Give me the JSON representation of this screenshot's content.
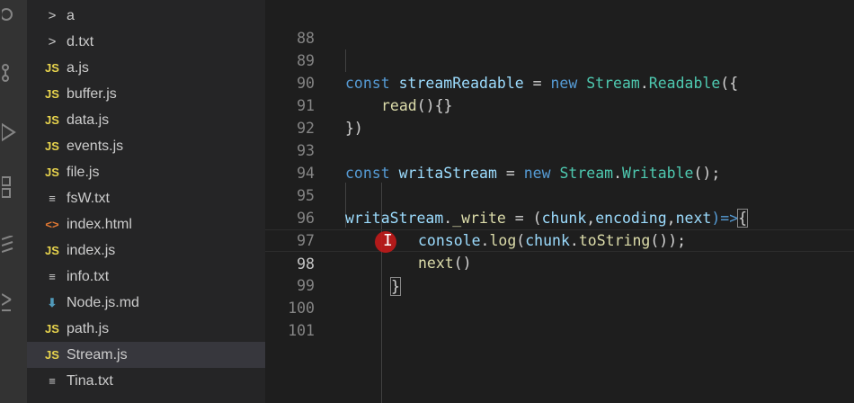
{
  "activity_bar": {
    "icons": [
      "search-icon",
      "source-control-icon",
      "run-debug-icon",
      "extensions-icon",
      "remote-icon",
      "settings-icon"
    ]
  },
  "explorer": {
    "items": [
      {
        "label": "a",
        "type": "folder"
      },
      {
        "label": "d.txt",
        "type": "folder"
      },
      {
        "label": "a.js",
        "type": "js"
      },
      {
        "label": "buffer.js",
        "type": "js"
      },
      {
        "label": "data.js",
        "type": "js"
      },
      {
        "label": "events.js",
        "type": "js"
      },
      {
        "label": "file.js",
        "type": "js"
      },
      {
        "label": "fsW.txt",
        "type": "txt"
      },
      {
        "label": "index.html",
        "type": "html"
      },
      {
        "label": "index.js",
        "type": "js"
      },
      {
        "label": "info.txt",
        "type": "txt"
      },
      {
        "label": "Node.js.md",
        "type": "md"
      },
      {
        "label": "path.js",
        "type": "js"
      },
      {
        "label": "Stream.js",
        "type": "js",
        "selected": true
      },
      {
        "label": "Tina.txt",
        "type": "txt"
      }
    ],
    "icon_glyphs": {
      "js": "JS",
      "html": "<>",
      "txt": "≡",
      "md": "⬇",
      "folder": ">"
    }
  },
  "editor": {
    "line_numbers": [
      "88",
      "89",
      "90",
      "91",
      "92",
      "93",
      "94",
      "95",
      "96",
      "97",
      "98",
      "99",
      "100",
      "101"
    ],
    "active_line": "98",
    "tokens": {
      "l89_kw": "const",
      "l89_var": "streamReadable",
      "l89_eq": " = ",
      "l89_new": "new",
      "l89_cls": "Stream",
      "l89_dot": ".",
      "l89_cls2": "Readable",
      "l89_end": "({",
      "l90_fn": "read",
      "l90_end": "(){}",
      "l91": "})",
      "l93_kw": "const",
      "l93_var": "writaStream",
      "l93_eq": " = ",
      "l93_new": "new",
      "l93_cls": "Stream",
      "l93_dot": ".",
      "l93_cls2": "Writable",
      "l93_end": "();",
      "l95_var": "writaStream",
      "l95_dot": ".",
      "l95_fn": "_write",
      "l95_eq": " = (",
      "l95_p1": "chunk",
      "l95_c1": ",",
      "l95_p2": "encoding",
      "l95_c2": ",",
      "l95_p3": "next",
      "l95_arrow": ")=>",
      "l95_end": "{",
      "l96_obj": "console",
      "l96_dot": ".",
      "l96_fn": "log",
      "l96_open": "(",
      "l96_arg": "chunk",
      "l96_dot2": ".",
      "l96_fn2": "toString",
      "l96_end": "());",
      "l97_fn": "next",
      "l97_end": "()",
      "l98": "}"
    }
  }
}
